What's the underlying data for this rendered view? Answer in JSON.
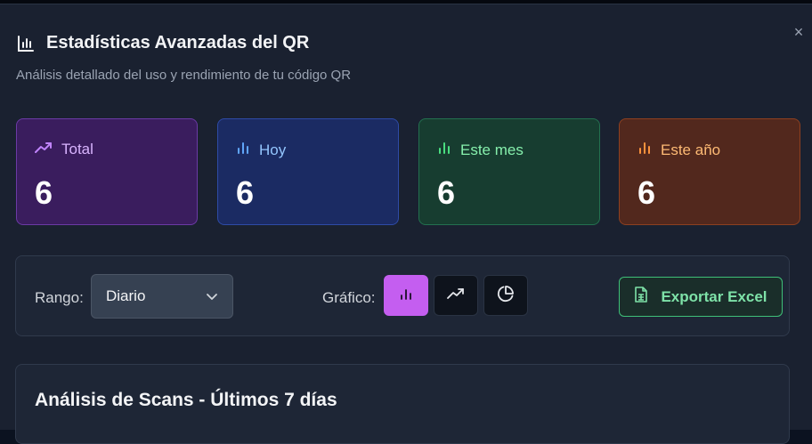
{
  "modal": {
    "title": "Estadísticas Avanzadas del QR",
    "subtitle": "Análisis detallado del uso y rendimiento de tu código QR",
    "close_icon": "×"
  },
  "stats": [
    {
      "label": "Total",
      "value": "6",
      "icon": "trending-up-icon",
      "color": "#c084fc"
    },
    {
      "label": "Hoy",
      "value": "6",
      "icon": "bar-chart-icon",
      "color": "#60a5fa"
    },
    {
      "label": "Este mes",
      "value": "6",
      "icon": "bar-chart-icon",
      "color": "#4ade80"
    },
    {
      "label": "Este año",
      "value": "6",
      "icon": "bar-chart-icon",
      "color": "#fb923c"
    }
  ],
  "controls": {
    "range_label": "Rango:",
    "range_value": "Diario",
    "graph_label": "Gráfico:",
    "graph_types": [
      "bar-chart-icon",
      "line-chart-icon",
      "pie-chart-icon"
    ],
    "selected_graph": "bar",
    "export_label": "Exportar Excel"
  },
  "analysis": {
    "title": "Análisis de Scans - Últimos 7 días"
  }
}
